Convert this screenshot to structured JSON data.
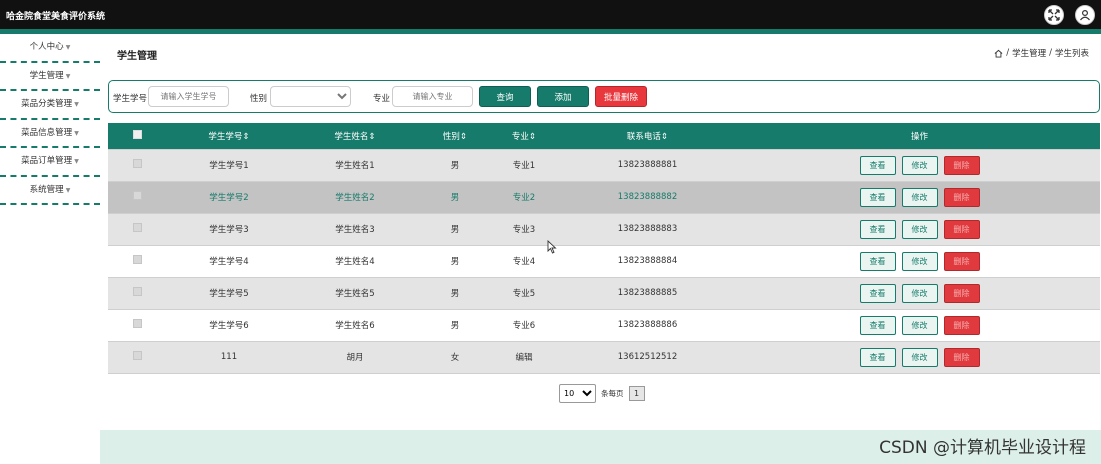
{
  "app": {
    "title": "哈金院食堂美食评价系统"
  },
  "colors": {
    "accent": "#177b6b",
    "danger": "#e8383d",
    "topbar": "#111111"
  },
  "header_icons": [
    "fullscreen-icon",
    "user-icon"
  ],
  "sidebar": {
    "items": [
      {
        "label": "个人中心"
      },
      {
        "label": "学生管理"
      },
      {
        "label": "菜品分类管理"
      },
      {
        "label": "菜品信息管理"
      },
      {
        "label": "菜品订单管理"
      },
      {
        "label": "系统管理"
      }
    ]
  },
  "page": {
    "title": "学生管理",
    "breadcrumb": {
      "sep": "/",
      "level1": "学生管理",
      "level2": "学生列表"
    }
  },
  "search": {
    "student_no_label": "学生学号",
    "student_no_placeholder": "请输入学生学号",
    "gender_label": "性别",
    "gender_value": "",
    "major_label": "专业",
    "major_placeholder": "请输入专业",
    "query_label": "查询",
    "add_label": "添加",
    "batch_delete_label": "批量删除"
  },
  "table": {
    "columns": [
      "学生学号",
      "学生姓名",
      "性别",
      "专业",
      "联系电话",
      "操作"
    ],
    "sort_mark": "⇕",
    "actions": {
      "view": "查看",
      "edit": "修改",
      "delete": "删除"
    },
    "rows": [
      {
        "no": "学生学号1",
        "name": "学生姓名1",
        "gender": "男",
        "major": "专业1",
        "phone": "13823888881"
      },
      {
        "no": "学生学号2",
        "name": "学生姓名2",
        "gender": "男",
        "major": "专业2",
        "phone": "13823888882"
      },
      {
        "no": "学生学号3",
        "name": "学生姓名3",
        "gender": "男",
        "major": "专业3",
        "phone": "13823888883"
      },
      {
        "no": "学生学号4",
        "name": "学生姓名4",
        "gender": "男",
        "major": "专业4",
        "phone": "13823888884"
      },
      {
        "no": "学生学号5",
        "name": "学生姓名5",
        "gender": "男",
        "major": "专业5",
        "phone": "13823888885"
      },
      {
        "no": "学生学号6",
        "name": "学生姓名6",
        "gender": "男",
        "major": "专业6",
        "phone": "13823888886"
      },
      {
        "no": "111",
        "name": "胡月",
        "gender": "女",
        "major": "编辑",
        "phone": "13612512512"
      }
    ]
  },
  "pager": {
    "page_size": "10",
    "per_page_label": "条每页",
    "current_page": "1"
  },
  "watermark": "CSDN @计算机毕业设计程"
}
